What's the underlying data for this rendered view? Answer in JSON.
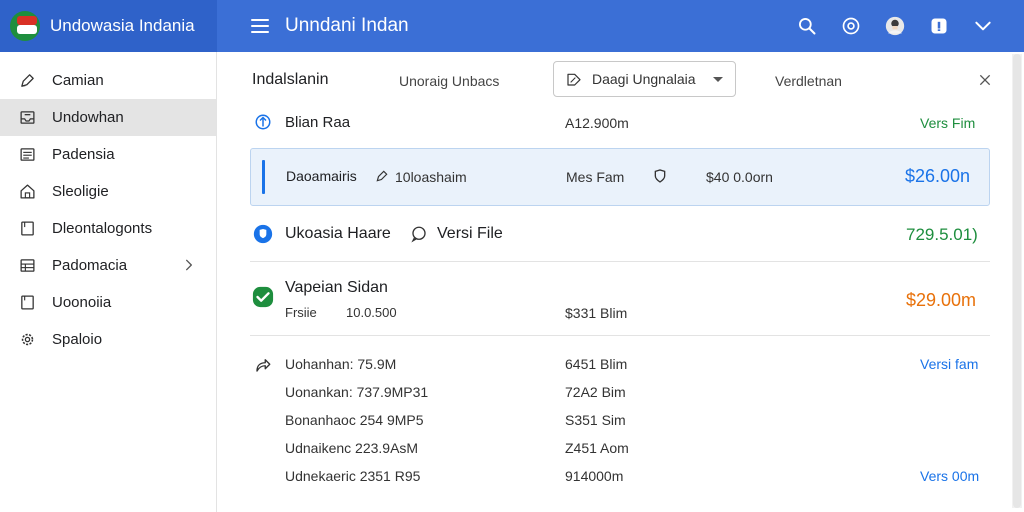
{
  "header": {
    "brand_title": "Undowasia Indania",
    "app_title": "Unndani Indan",
    "icons": [
      "search-icon",
      "settings-icon",
      "avatar",
      "notification-icon",
      "chevron-down-icon"
    ]
  },
  "sidebar": {
    "items": [
      {
        "label": "Camian",
        "icon": "pen-icon"
      },
      {
        "label": "Undowhan",
        "icon": "inbox-icon",
        "active": true
      },
      {
        "label": "Padensia",
        "icon": "list-icon"
      },
      {
        "label": "Sleoligie",
        "icon": "home-icon"
      },
      {
        "label": "Dleontalogonts",
        "icon": "document-icon"
      },
      {
        "label": "Padomacia",
        "icon": "grid-icon",
        "has_children": true
      },
      {
        "label": "Uoonoiia",
        "icon": "file-icon"
      },
      {
        "label": "Spaloio",
        "icon": "gear-icon"
      }
    ]
  },
  "tabs": {
    "main": "Indalslanin",
    "sub": "Unoraig Unbacs",
    "dropdown_selected": "Daagi Ungnalaia",
    "version": "Verdletnan"
  },
  "rows": {
    "r1": {
      "name": "Blian Raa",
      "amount": "A12.900m",
      "status": "Vers Fim"
    },
    "r2": {
      "name": "Daoamairis",
      "note": "10loashaim",
      "label": "Mes Fam",
      "amount": "$40 0.0orn",
      "total": "$26.00n"
    },
    "r3": {
      "name": "Ukoasia Haare",
      "link": "Versi File",
      "total": "729.5.01)"
    },
    "r4": {
      "name": "Vapeian Sidan",
      "sub_label": "Frsiie",
      "sub_value": "10.0.500",
      "amount": "$331 Blim",
      "total": "$29.00m"
    },
    "r5": {
      "lines": [
        {
          "left": "Uohanhan: 75.9M",
          "mid": "6451 Blim",
          "right": "Versi fam"
        },
        {
          "left": "Uonankan: 737.9MP31",
          "mid": "72A2 Bim",
          "right": ""
        },
        {
          "left": "Bonanhaoc 254 9MP5",
          "mid": "S351 Sim",
          "right": ""
        },
        {
          "left": "Udnaikenc 223.9AsM",
          "mid": "Z451 Aom",
          "right": ""
        },
        {
          "left": "Udnekaeric 2351 R95",
          "mid": "914000m",
          "right": "Vers 00m"
        }
      ]
    }
  },
  "colors": {
    "header": "#3b6fd6",
    "brand_bg": "#2f62c9",
    "green": "#1e8e3e",
    "blue": "#1a73e8",
    "orange": "#e8710a",
    "highlight": "#eaf2fb"
  }
}
